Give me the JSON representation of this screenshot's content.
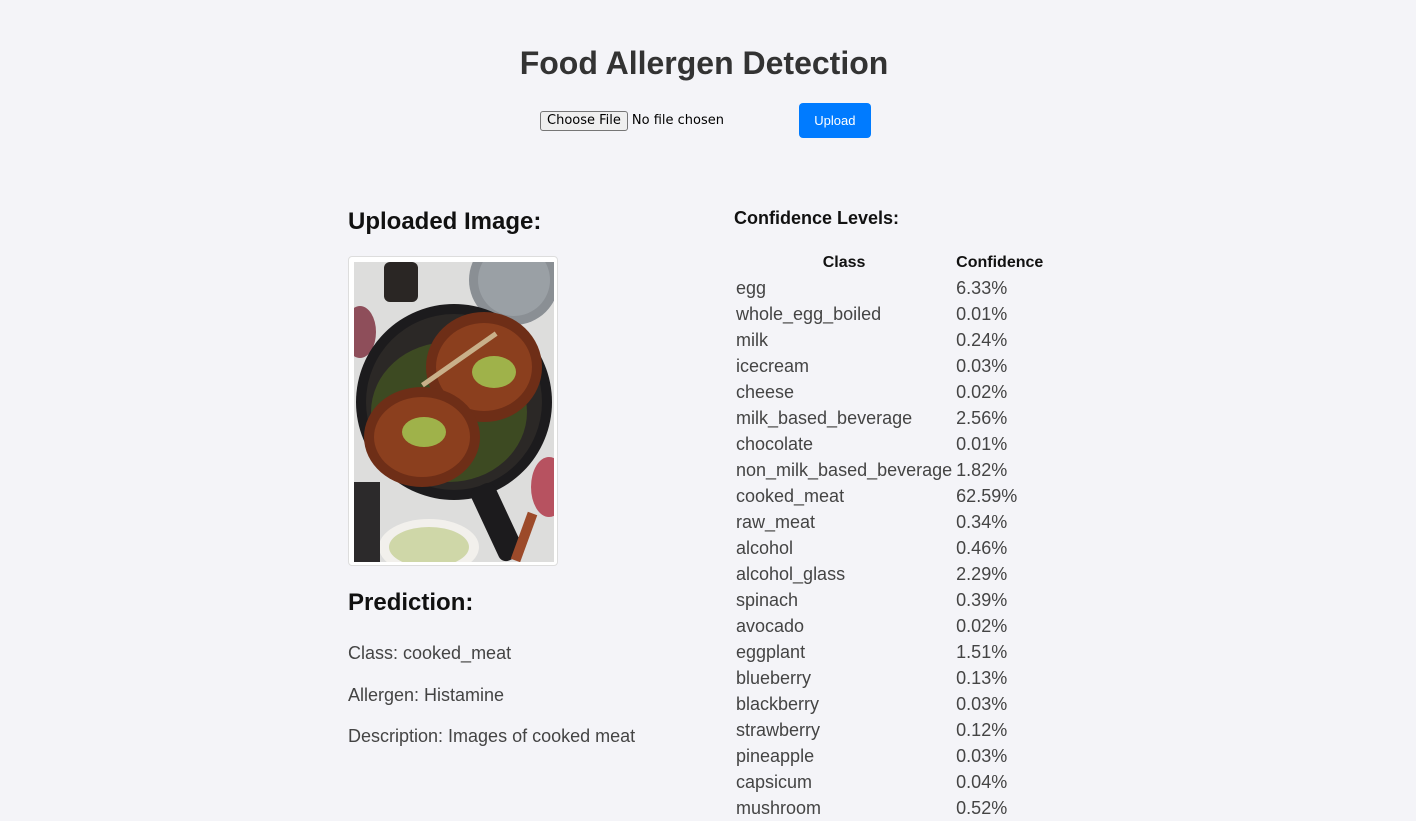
{
  "page": {
    "title": "Food Allergen Detection"
  },
  "upload": {
    "choose_file_label": "Choose File",
    "file_status": "No file chosen",
    "upload_label": "Upload"
  },
  "uploaded": {
    "heading": "Uploaded Image:"
  },
  "prediction": {
    "heading": "Prediction:",
    "class_text": "Class: cooked_meat",
    "allergen_text": "Allergen: Histamine",
    "description_text": "Description: Images of cooked meat"
  },
  "confidence": {
    "heading": "Confidence Levels:",
    "col_class": "Class",
    "col_confidence": "Confidence",
    "rows": [
      {
        "cls": "egg",
        "conf": "6.33%"
      },
      {
        "cls": "whole_egg_boiled",
        "conf": "0.01%"
      },
      {
        "cls": "milk",
        "conf": "0.24%"
      },
      {
        "cls": "icecream",
        "conf": "0.03%"
      },
      {
        "cls": "cheese",
        "conf": "0.02%"
      },
      {
        "cls": "milk_based_beverage",
        "conf": "2.56%"
      },
      {
        "cls": "chocolate",
        "conf": "0.01%"
      },
      {
        "cls": "non_milk_based_beverage",
        "conf": "1.82%"
      },
      {
        "cls": "cooked_meat",
        "conf": "62.59%"
      },
      {
        "cls": "raw_meat",
        "conf": "0.34%"
      },
      {
        "cls": "alcohol",
        "conf": "0.46%"
      },
      {
        "cls": "alcohol_glass",
        "conf": "2.29%"
      },
      {
        "cls": "spinach",
        "conf": "0.39%"
      },
      {
        "cls": "avocado",
        "conf": "0.02%"
      },
      {
        "cls": "eggplant",
        "conf": "1.51%"
      },
      {
        "cls": "blueberry",
        "conf": "0.13%"
      },
      {
        "cls": "blackberry",
        "conf": "0.03%"
      },
      {
        "cls": "strawberry",
        "conf": "0.12%"
      },
      {
        "cls": "pineapple",
        "conf": "0.03%"
      },
      {
        "cls": "capsicum",
        "conf": "0.04%"
      },
      {
        "cls": "mushroom",
        "conf": "0.52%"
      }
    ]
  },
  "colors": {
    "background": "#f4f4f8",
    "accent": "#007bff"
  }
}
